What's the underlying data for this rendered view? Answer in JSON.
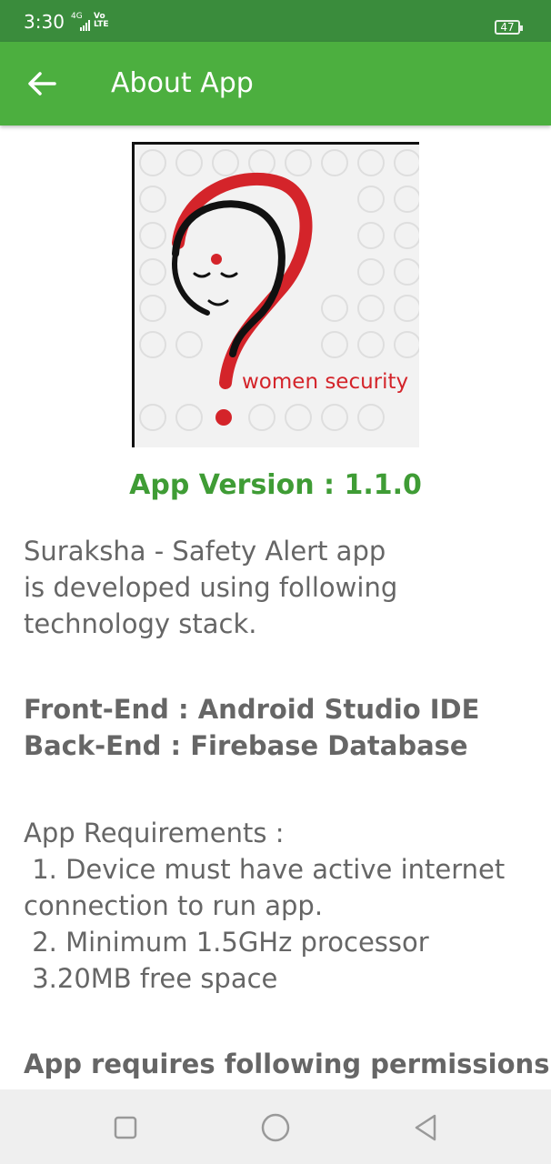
{
  "status_bar": {
    "time": "3:30",
    "network": "4G",
    "volte_top": "Vo",
    "volte_bottom": "LTE",
    "battery": "47"
  },
  "app_bar": {
    "title": "About App",
    "back_icon": "arrow-left-icon",
    "color": "#4caf3f"
  },
  "logo": {
    "text": "women security",
    "accent": "#d4242a"
  },
  "version": {
    "label": "App Version : 1.1.0",
    "color": "#3f9c35"
  },
  "content": {
    "intro_line1": "Suraksha - Safety Alert app",
    "intro_line2": "is developed using following",
    "intro_line3": "technology stack.",
    "frontend": "Front-End : Android Studio IDE",
    "backend": "Back-End : Firebase Database",
    "req_title": "App Requirements :",
    "req_1a": " 1. Device must have active internet",
    "req_1b": "connection to run app.",
    "req_2": " 2. Minimum 1.5GHz processor",
    "req_3": " 3.20MB free space",
    "permissions_title": "App requires following permissions:"
  },
  "nav_bar": {
    "recent_icon": "square-icon",
    "home_icon": "circle-icon",
    "back_icon": "triangle-back-icon"
  }
}
